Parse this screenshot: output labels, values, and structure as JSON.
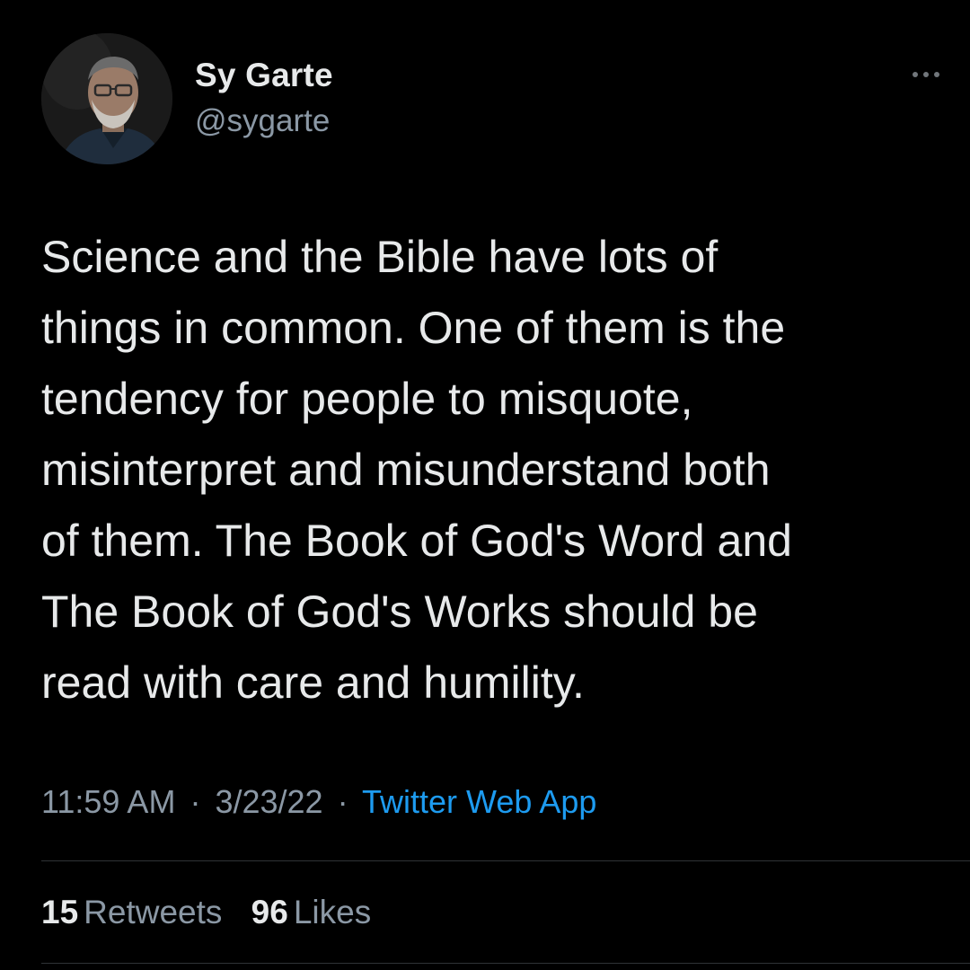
{
  "author": {
    "display_name": "Sy Garte",
    "handle": "@sygarte"
  },
  "tweet": {
    "text": "Science and the Bible have lots of\nthings in common. One of them is the\ntendency for people to misquote,\nmisinterpret and misunderstand both\nof them. The Book of God's Word and\nThe Book of God's Works should be\nread with care and humility.",
    "time": "11:59 AM",
    "separator": "·",
    "date": "3/23/22",
    "source": "Twitter Web App"
  },
  "stats": {
    "retweets_count": "15",
    "retweets_label": "Retweets",
    "likes_count": "96",
    "likes_label": "Likes"
  },
  "icons": {
    "more": "more-options-icon"
  },
  "colors": {
    "background": "#000000",
    "primary_text": "#e7e9ea",
    "secondary_text": "#8b98a5",
    "link": "#1d9bf0",
    "divider": "#2f3336"
  }
}
